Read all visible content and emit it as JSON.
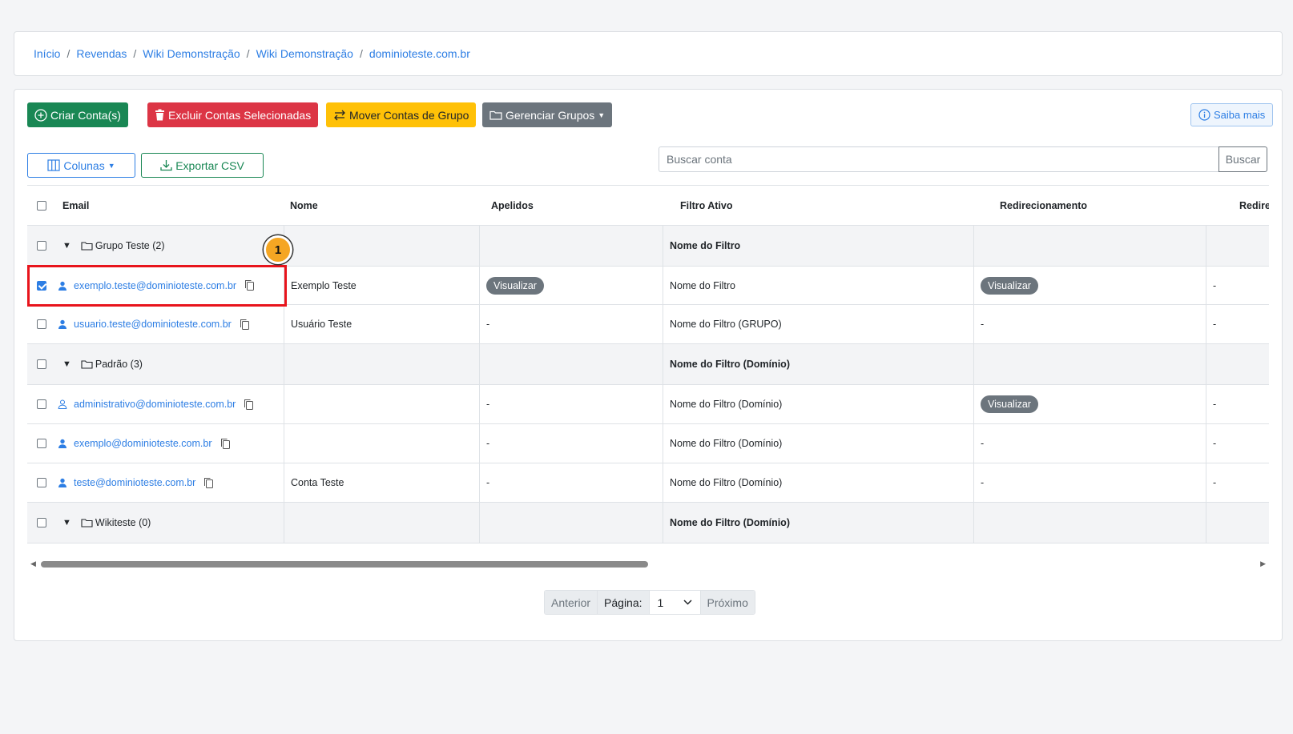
{
  "breadcrumb": {
    "items": [
      "Início",
      "Revendas",
      "Wiki Demonstração",
      "Wiki Demonstração",
      "dominioteste.com.br"
    ]
  },
  "toolbar": {
    "create": "Criar Conta(s)",
    "delete": "Excluir Contas Selecionadas",
    "move": "Mover Contas de Grupo",
    "manage": "Gerenciar Grupos",
    "learn_more": "Saiba mais",
    "columns": "Colunas",
    "export": "Exportar CSV"
  },
  "search": {
    "placeholder": "Buscar conta",
    "button": "Buscar"
  },
  "table": {
    "headers": [
      "Email",
      "Nome",
      "Apelidos",
      "Filtro Ativo",
      "Redirecionamento",
      "Redirec"
    ],
    "rows": [
      {
        "type": "group",
        "label": "Grupo Teste (2)",
        "filter": "Nome do Filtro"
      },
      {
        "type": "account",
        "email": "exemplo.teste@dominioteste.com.br",
        "name": "Exemplo Teste",
        "aliases": "Visualizar",
        "filter": "Nome do Filtro",
        "redirect": "Visualizar",
        "redirect2": "-",
        "checked": true
      },
      {
        "type": "account",
        "email": "usuario.teste@dominioteste.com.br",
        "name": "Usuário Teste",
        "aliases": "-",
        "filter": "Nome do Filtro (GRUPO)",
        "redirect": "-",
        "redirect2": "-"
      },
      {
        "type": "group",
        "label": "Padrão (3)",
        "filter": "Nome do Filtro (Domínio)"
      },
      {
        "type": "account",
        "email": "administrativo@dominioteste.com.br",
        "name": "",
        "aliases": "-",
        "filter": "Nome do Filtro (Domínio)",
        "redirect": "Visualizar",
        "redirect2": "-"
      },
      {
        "type": "account",
        "email": "exemplo@dominioteste.com.br",
        "name": "",
        "aliases": "-",
        "filter": "Nome do Filtro (Domínio)",
        "redirect": "-",
        "redirect2": "-"
      },
      {
        "type": "account",
        "email": "teste@dominioteste.com.br",
        "name": "Conta Teste",
        "aliases": "-",
        "filter": "Nome do Filtro (Domínio)",
        "redirect": "-",
        "redirect2": "-"
      },
      {
        "type": "group",
        "label": "Wikiteste (0)",
        "filter": "Nome do Filtro (Domínio)"
      }
    ]
  },
  "pagination": {
    "prev": "Anterior",
    "page_label": "Página:",
    "page": "1",
    "next": "Próximo"
  },
  "annotation": {
    "step": "1"
  },
  "colors": {
    "primary": "#2d7ee4",
    "success": "#198754",
    "danger": "#dc3545",
    "warning": "#ffc107",
    "secondary": "#6c757d",
    "highlight": "#e8141c",
    "badge": "#f5a623"
  }
}
